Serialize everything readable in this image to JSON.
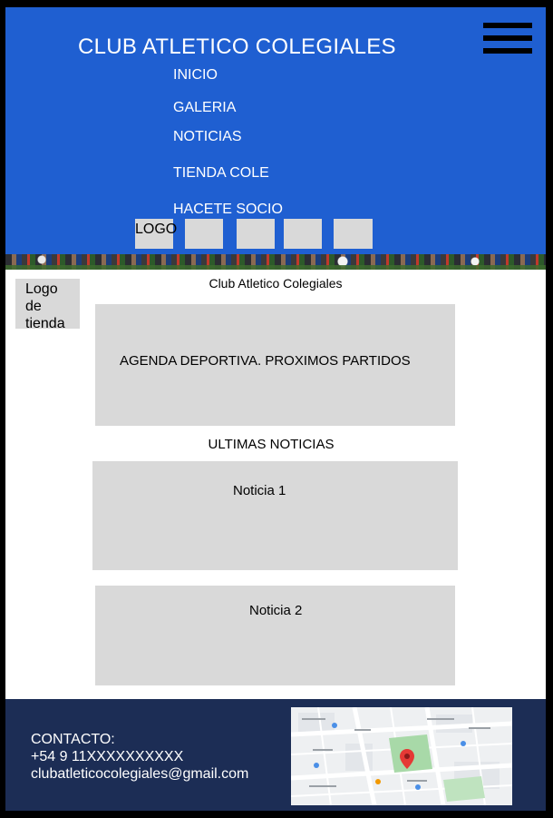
{
  "header": {
    "title": "CLUB ATLETICO COLEGIALES",
    "menu_icon": "hamburger-menu-icon",
    "nav": [
      {
        "label": "INICIO"
      },
      {
        "label": "GALERIA"
      },
      {
        "label": "NOTICIAS"
      },
      {
        "label": "TIENDA COLE"
      },
      {
        "label": "HACETE SOCIO"
      }
    ],
    "logo_label": "LOGO"
  },
  "sidebar": {
    "shop_logo_label": "Logo de tienda"
  },
  "main": {
    "title": "Club Atletico Colegiales",
    "agenda_label": "AGENDA DEPORTIVA. PROXIMOS PARTIDOS",
    "news_title": "ULTIMAS NOTICIAS",
    "news": [
      {
        "title": "Noticia 1"
      },
      {
        "title": "Noticia 2"
      }
    ]
  },
  "footer": {
    "contact_heading": "CONTACTO:",
    "phone": "+54 9 11XXXXXXXXXX",
    "email": "clubatleticocolegiales@gmail.com"
  },
  "colors": {
    "header_bg": "#1f5fd1",
    "footer_bg": "#1c2d55",
    "placeholder": "#d9d9d9"
  }
}
